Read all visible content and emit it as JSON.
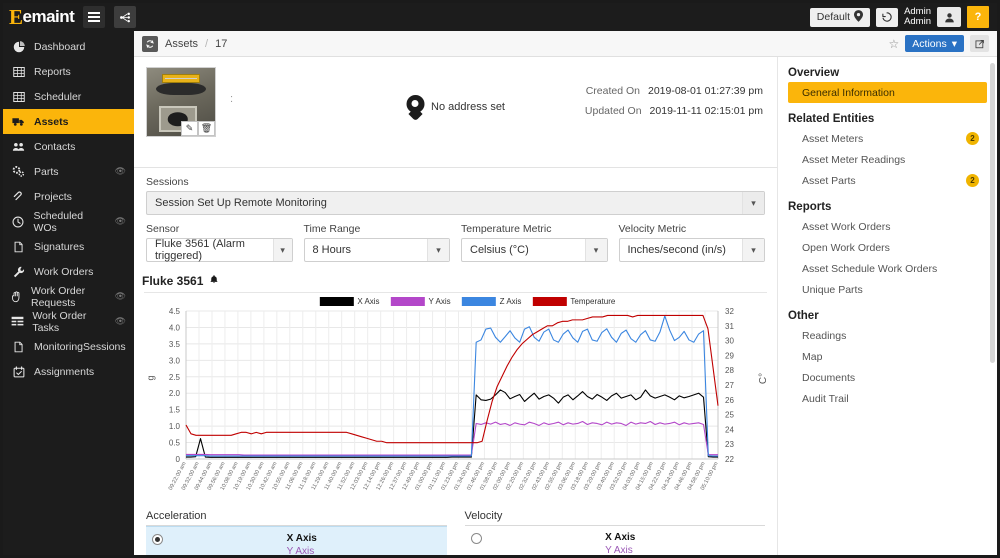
{
  "topbar": {
    "brand": "emaint",
    "brand_initial": "E",
    "menu_icon": "hamburger-icon",
    "nodes_icon": "sitemap-icon",
    "site_selector": "Default",
    "site_icon": "location-pin-icon",
    "history_icon": "history-icon",
    "user_line1": "Admin",
    "user_line2": "Admin",
    "avatar_icon": "user-icon",
    "help_label": "?"
  },
  "sidebar": {
    "items": [
      {
        "label": "Dashboard",
        "icon": "pie-chart-icon",
        "active": false,
        "eye": false
      },
      {
        "label": "Reports",
        "icon": "table-icon",
        "active": false,
        "eye": false
      },
      {
        "label": "Scheduler",
        "icon": "calendar-grid-icon",
        "active": false,
        "eye": false
      },
      {
        "label": "Assets",
        "icon": "truck-icon",
        "active": true,
        "eye": false
      },
      {
        "label": "Contacts",
        "icon": "people-icon",
        "active": false,
        "eye": false
      },
      {
        "label": "Parts",
        "icon": "cogs-icon",
        "active": false,
        "eye": true
      },
      {
        "label": "Projects",
        "icon": "paperclip-icon",
        "active": false,
        "eye": false
      },
      {
        "label": "Scheduled WOs",
        "icon": "clock-icon",
        "active": false,
        "eye": true
      },
      {
        "label": "Signatures",
        "icon": "document-icon",
        "active": false,
        "eye": false
      },
      {
        "label": "Work Orders",
        "icon": "wrench-icon",
        "active": false,
        "eye": false
      },
      {
        "label": "Work Order Requests",
        "icon": "hand-icon",
        "active": false,
        "eye": true
      },
      {
        "label": "Work Order Tasks",
        "icon": "list-icon",
        "active": false,
        "eye": true
      },
      {
        "label": "MonitoringSessions",
        "icon": "document-icon",
        "active": false,
        "eye": false
      },
      {
        "label": "Assignments",
        "icon": "calendar-check-icon",
        "active": false,
        "eye": false
      }
    ]
  },
  "breadcrumb": {
    "icon": "refresh-icon",
    "module": "Assets",
    "separator": "/",
    "record_id": "17",
    "star_icon": "star-outline-icon",
    "actions_label": "Actions",
    "actions_caret": "▾",
    "share_icon": "external-link-icon"
  },
  "asset": {
    "thumb_alt": "asset-photo",
    "edit_icon": "pencil-icon",
    "delete_icon": "trash-icon",
    "title_placeholder": ":",
    "address_text": "No address set",
    "address_icon": "map-pin-icon",
    "created_label": "Created On",
    "created_value": "2019-08-01 01:27:39 pm",
    "updated_label": "Updated On",
    "updated_value": "2019-11-11 02:15:01 pm"
  },
  "form": {
    "sessions_label": "Sessions",
    "sessions_value": "Session Set Up Remote Monitoring",
    "sensor_label": "Sensor",
    "sensor_value": "Fluke 3561 (Alarm triggered)",
    "time_range_label": "Time Range",
    "time_range_value": "8 Hours",
    "temperature_metric_label": "Temperature Metric",
    "temperature_metric_value": "Celsius (°C)",
    "velocity_metric_label": "Velocity Metric",
    "velocity_metric_value": "Inches/second (in/s)",
    "caret": "▾"
  },
  "chart_header": {
    "title": "Fluke 3561",
    "alarm_icon": "bell-icon"
  },
  "chart_data": {
    "type": "line",
    "title": "Fluke 3561",
    "xlabel": "",
    "ylabel": "g",
    "ylabel_right": "C°",
    "ylim": [
      0,
      4.5
    ],
    "yticks": [
      0,
      0.5,
      1.0,
      1.5,
      2.0,
      2.5,
      3.0,
      3.5,
      4.0,
      4.5
    ],
    "ytick_labels": [
      "0",
      "0.5",
      "1.0",
      "1.5",
      "2.0",
      "2.5",
      "3.0",
      "3.5",
      "4.0",
      "4.5"
    ],
    "y2lim": [
      22,
      32
    ],
    "y2ticks": [
      22,
      23,
      24,
      25,
      26,
      27,
      28,
      29,
      30,
      31,
      32
    ],
    "grid": true,
    "legend_position": "top-center",
    "legend": [
      "X Axis",
      "Y Axis",
      "Z Axis",
      "Temperature"
    ],
    "colors": {
      "x_axis": "#000000",
      "y_axis": "#b347c9",
      "z_axis": "#3b86e0",
      "temperature": "#c00000"
    },
    "x_tick_labels": [
      "09:22:00 am",
      "09:32:00 am",
      "09:44:00 am",
      "09:56:00 am",
      "10:08:00 am",
      "10:19:00 am",
      "10:30:00 am",
      "10:42:00 am",
      "10:55:00 am",
      "11:06:00 am",
      "11:18:00 am",
      "11:29:00 am",
      "11:40:00 am",
      "11:52:00 am",
      "12:03:00 pm",
      "12:14:00 pm",
      "12:26:00 pm",
      "12:37:00 pm",
      "12:49:00 pm",
      "01:00:00 pm",
      "01:11:00 pm",
      "01:23:00 pm",
      "01:34:00 pm",
      "01:46:00 pm",
      "01:58:00 pm",
      "02:09:00 pm",
      "02:20:00 pm",
      "02:32:00 pm",
      "02:43:00 pm",
      "02:55:00 pm",
      "03:06:00 pm",
      "03:18:00 pm",
      "03:29:00 pm",
      "03:40:00 pm",
      "03:52:00 pm",
      "04:03:00 pm",
      "04:15:00 pm",
      "04:22:00 pm",
      "04:34:00 pm",
      "04:46:00 pm",
      "04:58:00 pm",
      "05:10:00 pm"
    ],
    "series": [
      {
        "name": "X Axis",
        "color": "#000000",
        "axis": "left",
        "values": [
          0.06,
          0.06,
          0.07,
          0.62,
          0.06,
          0.05,
          0.05,
          0.05,
          0.05,
          0.05,
          0.05,
          0.05,
          0.05,
          0.05,
          0.05,
          0.05,
          0.05,
          0.05,
          0.05,
          0.05,
          0.05,
          0.05,
          0.05,
          0.05,
          0.05,
          0.05,
          0.05,
          0.05,
          0.05,
          0.05,
          0.05,
          0.05,
          0.05,
          0.05,
          0.05,
          0.05,
          0.05,
          0.05,
          0.05,
          0.05,
          0.05,
          0.05,
          0.05,
          0.05,
          0.05,
          0.05,
          0.05,
          0.05,
          0.05,
          0.05,
          0.05,
          0.05,
          0.05,
          0.05,
          0.05,
          0.06,
          0.06,
          0.06,
          0.06,
          0.06,
          1.95,
          1.8,
          1.78,
          1.82,
          1.95,
          2.1,
          2.02,
          1.83,
          1.9,
          1.96,
          1.75,
          1.88,
          2.0,
          1.82,
          1.9,
          1.95,
          1.85,
          1.7,
          1.88,
          1.95,
          1.8,
          1.92,
          2.05,
          1.9,
          1.82,
          1.96,
          1.88,
          1.78,
          1.92,
          2.0,
          1.85,
          1.9,
          1.95,
          1.8,
          1.88,
          2.1,
          1.92,
          1.85,
          1.9,
          1.95,
          1.88,
          1.8,
          1.92,
          1.86,
          1.9,
          1.95,
          2.0,
          1.88,
          0.07,
          0.06,
          0.06
        ]
      },
      {
        "name": "Y Axis",
        "color": "#b347c9",
        "axis": "left",
        "values": [
          0.14,
          0.14,
          0.14,
          0.14,
          0.14,
          0.13,
          0.13,
          0.13,
          0.13,
          0.13,
          0.13,
          0.13,
          0.12,
          0.12,
          0.12,
          0.12,
          0.12,
          0.12,
          0.12,
          0.12,
          0.12,
          0.12,
          0.12,
          0.12,
          0.12,
          0.12,
          0.12,
          0.12,
          0.12,
          0.12,
          0.12,
          0.12,
          0.12,
          0.12,
          0.12,
          0.12,
          0.12,
          0.12,
          0.12,
          0.12,
          0.12,
          0.12,
          0.12,
          0.12,
          0.12,
          0.12,
          0.12,
          0.12,
          0.12,
          0.12,
          0.12,
          0.12,
          0.12,
          0.12,
          0.12,
          0.12,
          0.12,
          0.12,
          0.12,
          0.12,
          1.08,
          1.05,
          1.1,
          1.06,
          1.12,
          1.05,
          1.08,
          1.02,
          1.1,
          1.06,
          1.04,
          1.12,
          1.08,
          1.02,
          1.1,
          1.05,
          1.08,
          1.12,
          1.04,
          1.1,
          1.06,
          1.08,
          1.14,
          1.05,
          1.1,
          1.08,
          1.04,
          1.12,
          1.06,
          1.1,
          1.08,
          1.02,
          1.12,
          1.06,
          1.1,
          1.08,
          1.14,
          1.05,
          1.1,
          1.06,
          1.08,
          1.12,
          1.04,
          1.1,
          1.06,
          1.08,
          1.1,
          1.05,
          0.13,
          0.13,
          0.13
        ]
      },
      {
        "name": "Z Axis",
        "color": "#3b86e0",
        "axis": "left",
        "values": [
          0.1,
          0.1,
          0.1,
          0.1,
          0.1,
          0.09,
          0.09,
          0.09,
          0.09,
          0.09,
          0.09,
          0.09,
          0.09,
          0.09,
          0.09,
          0.09,
          0.09,
          0.09,
          0.09,
          0.09,
          0.09,
          0.09,
          0.09,
          0.09,
          0.09,
          0.09,
          0.09,
          0.09,
          0.09,
          0.09,
          0.09,
          0.09,
          0.09,
          0.09,
          0.09,
          0.09,
          0.09,
          0.09,
          0.09,
          0.09,
          0.09,
          0.09,
          0.09,
          0.09,
          0.09,
          0.09,
          0.09,
          0.09,
          0.09,
          0.09,
          0.09,
          0.09,
          0.09,
          0.09,
          0.09,
          0.09,
          0.09,
          0.09,
          0.09,
          0.09,
          3.55,
          3.62,
          3.95,
          3.98,
          3.7,
          3.55,
          3.72,
          3.9,
          3.68,
          3.55,
          3.95,
          4.02,
          3.7,
          3.58,
          3.86,
          3.95,
          3.62,
          3.55,
          3.8,
          3.92,
          3.68,
          3.55,
          3.88,
          3.95,
          3.62,
          3.58,
          3.85,
          3.96,
          3.7,
          3.55,
          3.82,
          3.92,
          3.66,
          3.55,
          3.78,
          3.9,
          3.62,
          3.58,
          3.86,
          4.35,
          3.92,
          3.6,
          3.7,
          3.88,
          3.62,
          3.55,
          3.8,
          3.9,
          0.1,
          0.09,
          0.09
        ]
      },
      {
        "name": "Temperature",
        "color": "#c00000",
        "axis": "right",
        "values": [
          24.3,
          23.7,
          23.6,
          23.6,
          23.6,
          23.6,
          23.6,
          23.6,
          23.6,
          23.6,
          23.7,
          23.8,
          23.8,
          23.7,
          23.8,
          23.7,
          23.8,
          23.8,
          23.8,
          23.8,
          23.8,
          23.8,
          23.8,
          23.8,
          23.8,
          23.8,
          23.8,
          23.8,
          23.8,
          23.8,
          23.8,
          23.8,
          23.8,
          23.7,
          23.6,
          23.5,
          23.4,
          23.3,
          23.2,
          23.2,
          23.1,
          23.1,
          23.1,
          23.1,
          23.1,
          23.1,
          23.1,
          23.1,
          23.1,
          23.1,
          23.1,
          23.1,
          23.1,
          23.1,
          23.1,
          23.1,
          23.1,
          23.1,
          23.1,
          23.2,
          24.6,
          25.9,
          26.9,
          27.6,
          28.3,
          28.9,
          29.4,
          29.8,
          30.1,
          30.4,
          30.6,
          30.8,
          31.0,
          31.0,
          31.2,
          31.3,
          31.3,
          31.4,
          31.4,
          31.4,
          31.5,
          31.6,
          31.6,
          31.6,
          31.7,
          31.7,
          31.7,
          31.7,
          31.7,
          31.6,
          31.7,
          31.7,
          31.7,
          31.7,
          31.7,
          31.7,
          31.7,
          31.7,
          31.7,
          31.7,
          31.7,
          31.7,
          31.7,
          31.7,
          30.8,
          28.2,
          25.6
        ]
      }
    ]
  },
  "bottom": {
    "acceleration": {
      "title": "Acceleration",
      "selected": true,
      "rows": [
        {
          "x_label": "X Axis",
          "y_label": "Y Axis"
        }
      ]
    },
    "velocity": {
      "title": "Velocity",
      "selected": false,
      "rows": [
        {
          "x_label": "X Axis",
          "y_label": "Y Axis"
        }
      ]
    }
  },
  "rightpanel": {
    "groups": [
      {
        "title": "Overview",
        "items": [
          {
            "label": "General Information",
            "active": true,
            "badge": ""
          }
        ]
      },
      {
        "title": "Related Entities",
        "items": [
          {
            "label": "Asset Meters",
            "active": false,
            "badge": "2"
          },
          {
            "label": "Asset Meter Readings",
            "active": false,
            "badge": ""
          },
          {
            "label": "Asset Parts",
            "active": false,
            "badge": "2"
          }
        ]
      },
      {
        "title": "Reports",
        "items": [
          {
            "label": "Asset Work Orders",
            "active": false,
            "badge": ""
          },
          {
            "label": "Open Work Orders",
            "active": false,
            "badge": ""
          },
          {
            "label": "Asset Schedule Work Orders",
            "active": false,
            "badge": ""
          },
          {
            "label": "Unique Parts",
            "active": false,
            "badge": ""
          }
        ]
      },
      {
        "title": "Other",
        "items": [
          {
            "label": "Readings",
            "active": false,
            "badge": ""
          },
          {
            "label": "Map",
            "active": false,
            "badge": ""
          },
          {
            "label": "Documents",
            "active": false,
            "badge": ""
          },
          {
            "label": "Audit Trail",
            "active": false,
            "badge": ""
          }
        ]
      }
    ]
  }
}
